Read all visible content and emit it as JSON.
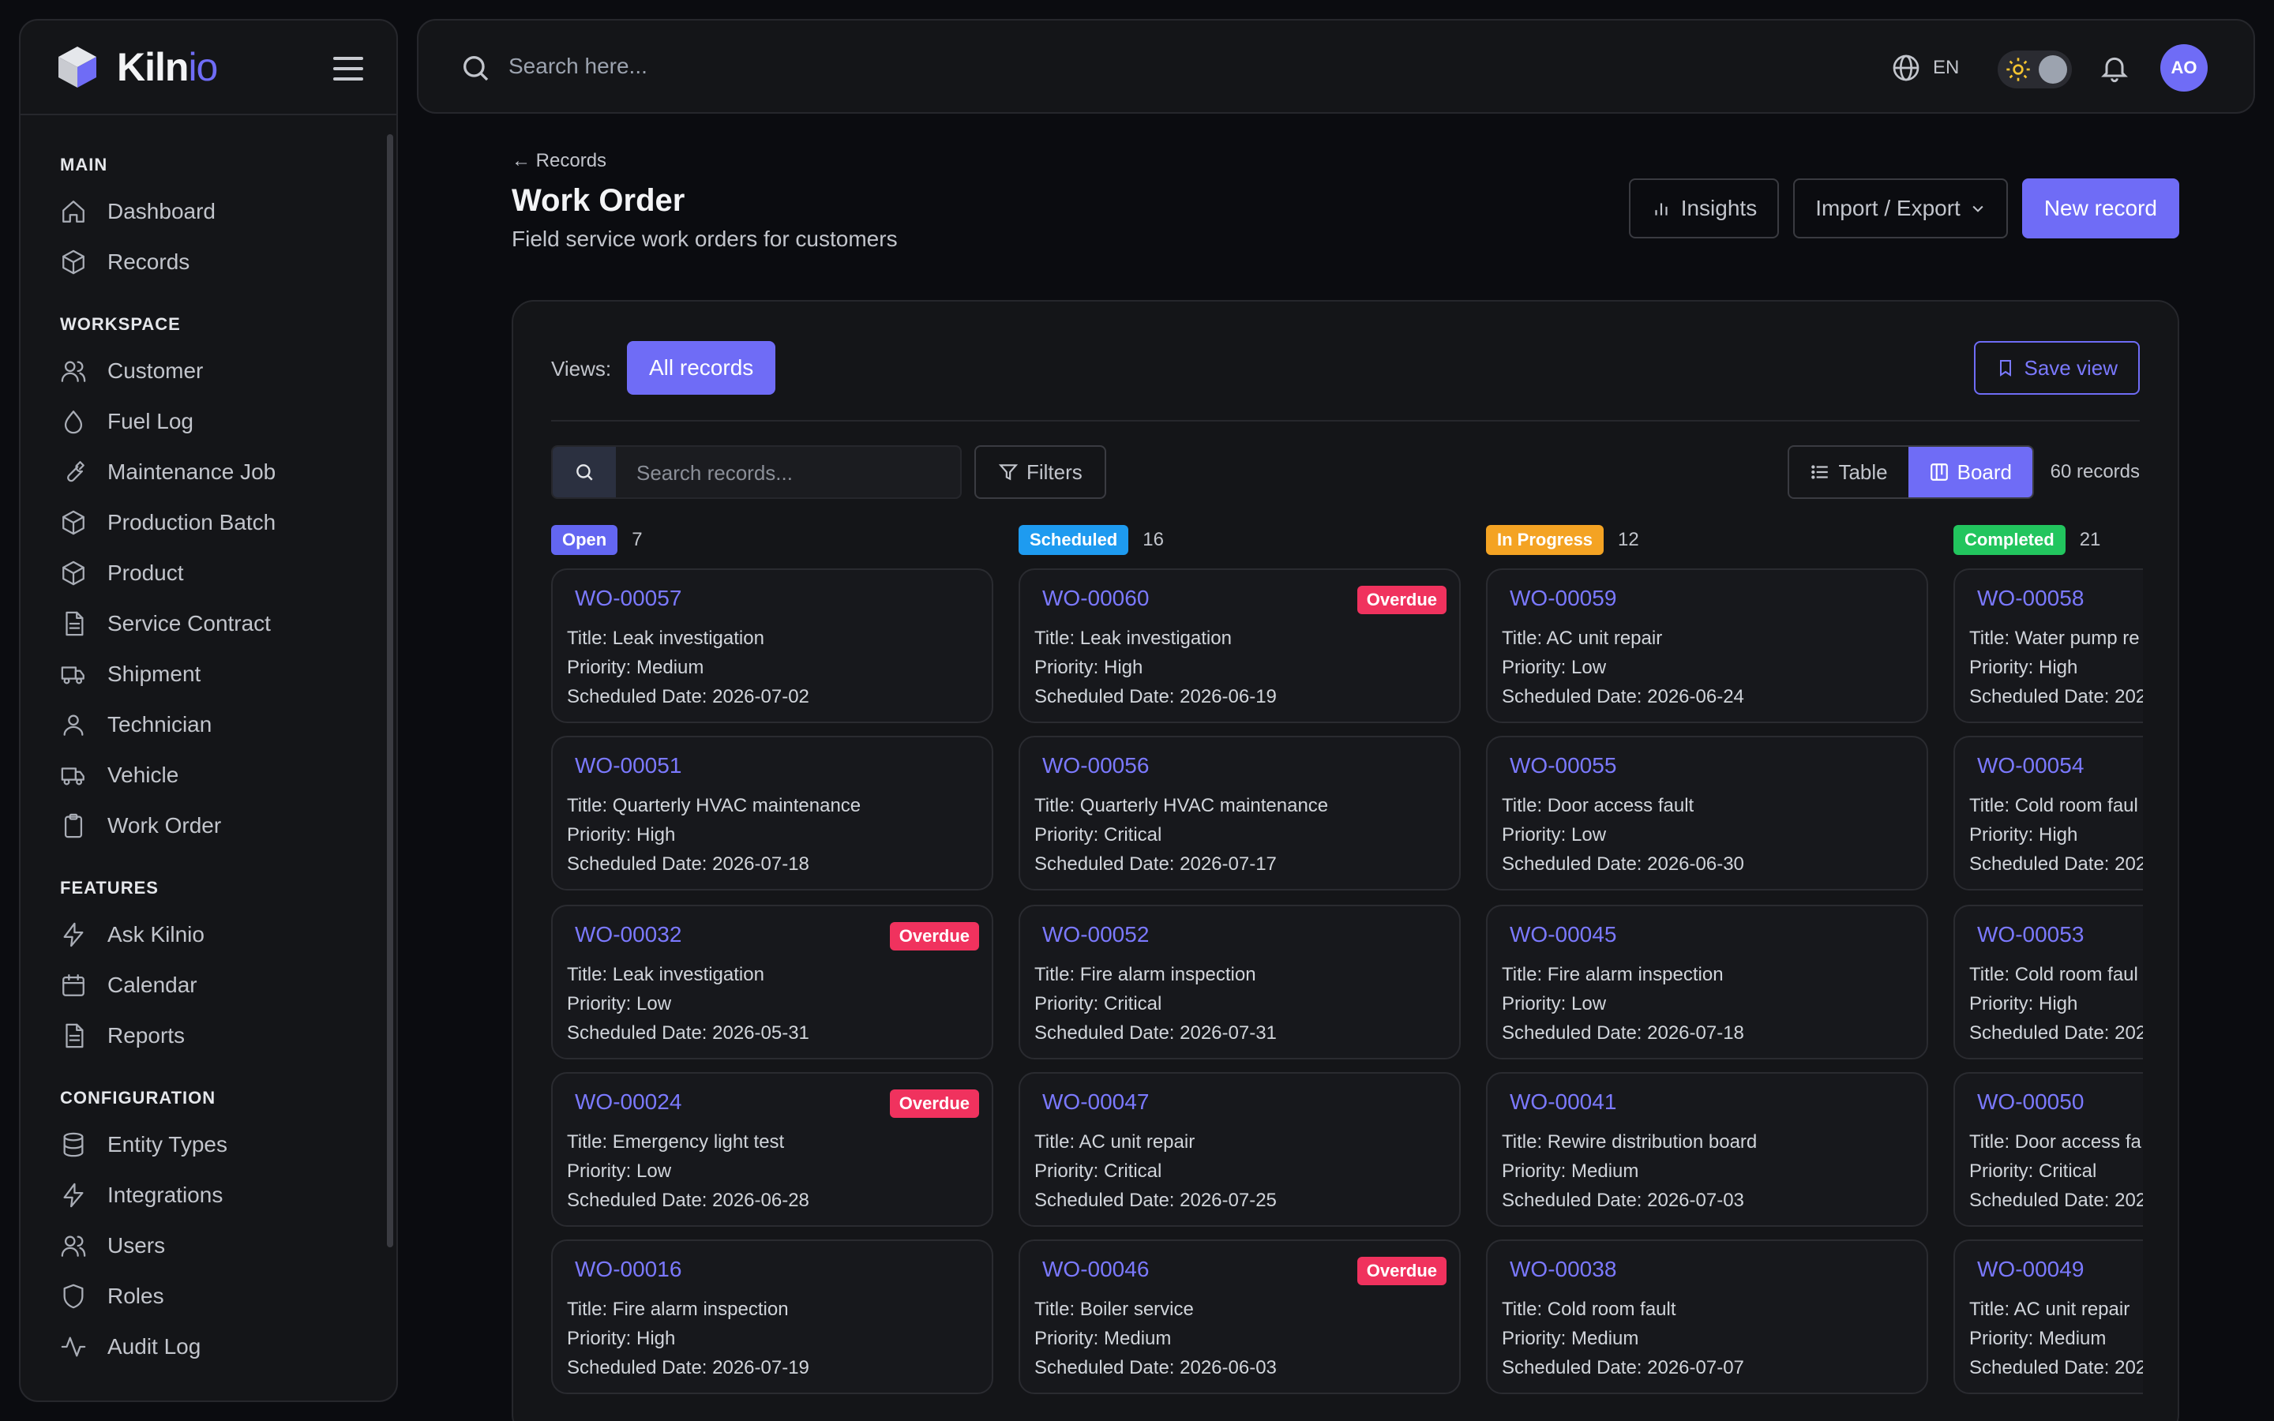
{
  "brand": {
    "name_a": "Kiln",
    "name_b": "io"
  },
  "sidebar": {
    "sections": [
      {
        "title": "MAIN",
        "items": [
          {
            "label": "Dashboard",
            "icon": "home-icon"
          },
          {
            "label": "Records",
            "icon": "box-icon"
          }
        ]
      },
      {
        "title": "WORKSPACE",
        "items": [
          {
            "label": "Customer",
            "icon": "users-icon"
          },
          {
            "label": "Fuel Log",
            "icon": "droplet-icon"
          },
          {
            "label": "Maintenance Job",
            "icon": "wrench-icon"
          },
          {
            "label": "Production Batch",
            "icon": "box-icon"
          },
          {
            "label": "Product",
            "icon": "box-icon"
          },
          {
            "label": "Service Contract",
            "icon": "document-icon"
          },
          {
            "label": "Shipment",
            "icon": "truck-icon"
          },
          {
            "label": "Technician",
            "icon": "user-icon"
          },
          {
            "label": "Vehicle",
            "icon": "truck-icon"
          },
          {
            "label": "Work Order",
            "icon": "clipboard-icon"
          }
        ]
      },
      {
        "title": "FEATURES",
        "items": [
          {
            "label": "Ask Kilnio",
            "icon": "bolt-icon"
          },
          {
            "label": "Calendar",
            "icon": "calendar-icon"
          },
          {
            "label": "Reports",
            "icon": "document-icon"
          }
        ]
      },
      {
        "title": "CONFIGURATION",
        "items": [
          {
            "label": "Entity Types",
            "icon": "database-icon"
          },
          {
            "label": "Integrations",
            "icon": "bolt-icon"
          },
          {
            "label": "Users",
            "icon": "users-icon"
          },
          {
            "label": "Roles",
            "icon": "shield-icon"
          },
          {
            "label": "Audit Log",
            "icon": "activity-icon"
          }
        ]
      }
    ]
  },
  "topbar": {
    "search_placeholder": "Search here...",
    "language": "EN",
    "avatar_initials": "AO"
  },
  "header": {
    "back_label": "← Records",
    "title": "Work Order",
    "subtitle": "Field service work orders for customers",
    "insights_label": "Insights",
    "import_export_label": "Import / Export",
    "new_record_label": "New record"
  },
  "toolbar": {
    "views_label": "Views:",
    "all_records_label": "All records",
    "save_view_label": "Save view",
    "search_placeholder": "Search records...",
    "filters_label": "Filters",
    "table_label": "Table",
    "board_label": "Board",
    "record_count": "60 records"
  },
  "colors": {
    "accent": "#6f6cf6",
    "open": "#6366f1",
    "scheduled": "#1e9bf0",
    "in_progress": "#f4a323",
    "completed": "#22c55e",
    "overdue": "#f0325e"
  },
  "board": {
    "overdue_label": "Overdue",
    "columns": [
      {
        "status": "Open",
        "count": "7",
        "color": "#6366f1",
        "cards": [
          {
            "id": "WO-00057",
            "title": "Title: Leak investigation",
            "priority": "Priority: Medium",
            "date": "Scheduled Date: 2026-07-02",
            "overdue": false
          },
          {
            "id": "WO-00051",
            "title": "Title: Quarterly HVAC maintenance",
            "priority": "Priority: High",
            "date": "Scheduled Date: 2026-07-18",
            "overdue": false
          },
          {
            "id": "WO-00032",
            "title": "Title: Leak investigation",
            "priority": "Priority: Low",
            "date": "Scheduled Date: 2026-05-31",
            "overdue": true
          },
          {
            "id": "WO-00024",
            "title": "Title: Emergency light test",
            "priority": "Priority: Low",
            "date": "Scheduled Date: 2026-06-28",
            "overdue": true
          },
          {
            "id": "WO-00016",
            "title": "Title: Fire alarm inspection",
            "priority": "Priority: High",
            "date": "Scheduled Date: 2026-07-19",
            "overdue": false
          }
        ]
      },
      {
        "status": "Scheduled",
        "count": "16",
        "color": "#1e9bf0",
        "cards": [
          {
            "id": "WO-00060",
            "title": "Title: Leak investigation",
            "priority": "Priority: High",
            "date": "Scheduled Date: 2026-06-19",
            "overdue": true
          },
          {
            "id": "WO-00056",
            "title": "Title: Quarterly HVAC maintenance",
            "priority": "Priority: Critical",
            "date": "Scheduled Date: 2026-07-17",
            "overdue": false
          },
          {
            "id": "WO-00052",
            "title": "Title: Fire alarm inspection",
            "priority": "Priority: Critical",
            "date": "Scheduled Date: 2026-07-31",
            "overdue": false
          },
          {
            "id": "WO-00047",
            "title": "Title: AC unit repair",
            "priority": "Priority: Critical",
            "date": "Scheduled Date: 2026-07-25",
            "overdue": false
          },
          {
            "id": "WO-00046",
            "title": "Title: Boiler service",
            "priority": "Priority: Medium",
            "date": "Scheduled Date: 2026-06-03",
            "overdue": true
          }
        ]
      },
      {
        "status": "In Progress",
        "count": "12",
        "color": "#f4a323",
        "cards": [
          {
            "id": "WO-00059",
            "title": "Title: AC unit repair",
            "priority": "Priority: Low",
            "date": "Scheduled Date: 2026-06-24",
            "overdue": false
          },
          {
            "id": "WO-00055",
            "title": "Title: Door access fault",
            "priority": "Priority: Low",
            "date": "Scheduled Date: 2026-06-30",
            "overdue": false
          },
          {
            "id": "WO-00045",
            "title": "Title: Fire alarm inspection",
            "priority": "Priority: Low",
            "date": "Scheduled Date: 2026-07-18",
            "overdue": false
          },
          {
            "id": "WO-00041",
            "title": "Title: Rewire distribution board",
            "priority": "Priority: Medium",
            "date": "Scheduled Date: 2026-07-03",
            "overdue": false
          },
          {
            "id": "WO-00038",
            "title": "Title: Cold room fault",
            "priority": "Priority: Medium",
            "date": "Scheduled Date: 2026-07-07",
            "overdue": false
          }
        ]
      },
      {
        "status": "Completed",
        "count": "21",
        "color": "#22c55e",
        "cards": [
          {
            "id": "WO-00058",
            "title": "Title: Water pump re",
            "priority": "Priority: High",
            "date": "Scheduled Date: 202",
            "overdue": false
          },
          {
            "id": "WO-00054",
            "title": "Title: Cold room faul",
            "priority": "Priority: High",
            "date": "Scheduled Date: 202",
            "overdue": false
          },
          {
            "id": "WO-00053",
            "title": "Title: Cold room faul",
            "priority": "Priority: High",
            "date": "Scheduled Date: 202",
            "overdue": false
          },
          {
            "id": "WO-00050",
            "title": "Title: Door access fa",
            "priority": "Priority: Critical",
            "date": "Scheduled Date: 202",
            "overdue": false
          },
          {
            "id": "WO-00049",
            "title": "Title: AC unit repair",
            "priority": "Priority: Medium",
            "date": "Scheduled Date: 202",
            "overdue": false
          }
        ]
      }
    ]
  }
}
